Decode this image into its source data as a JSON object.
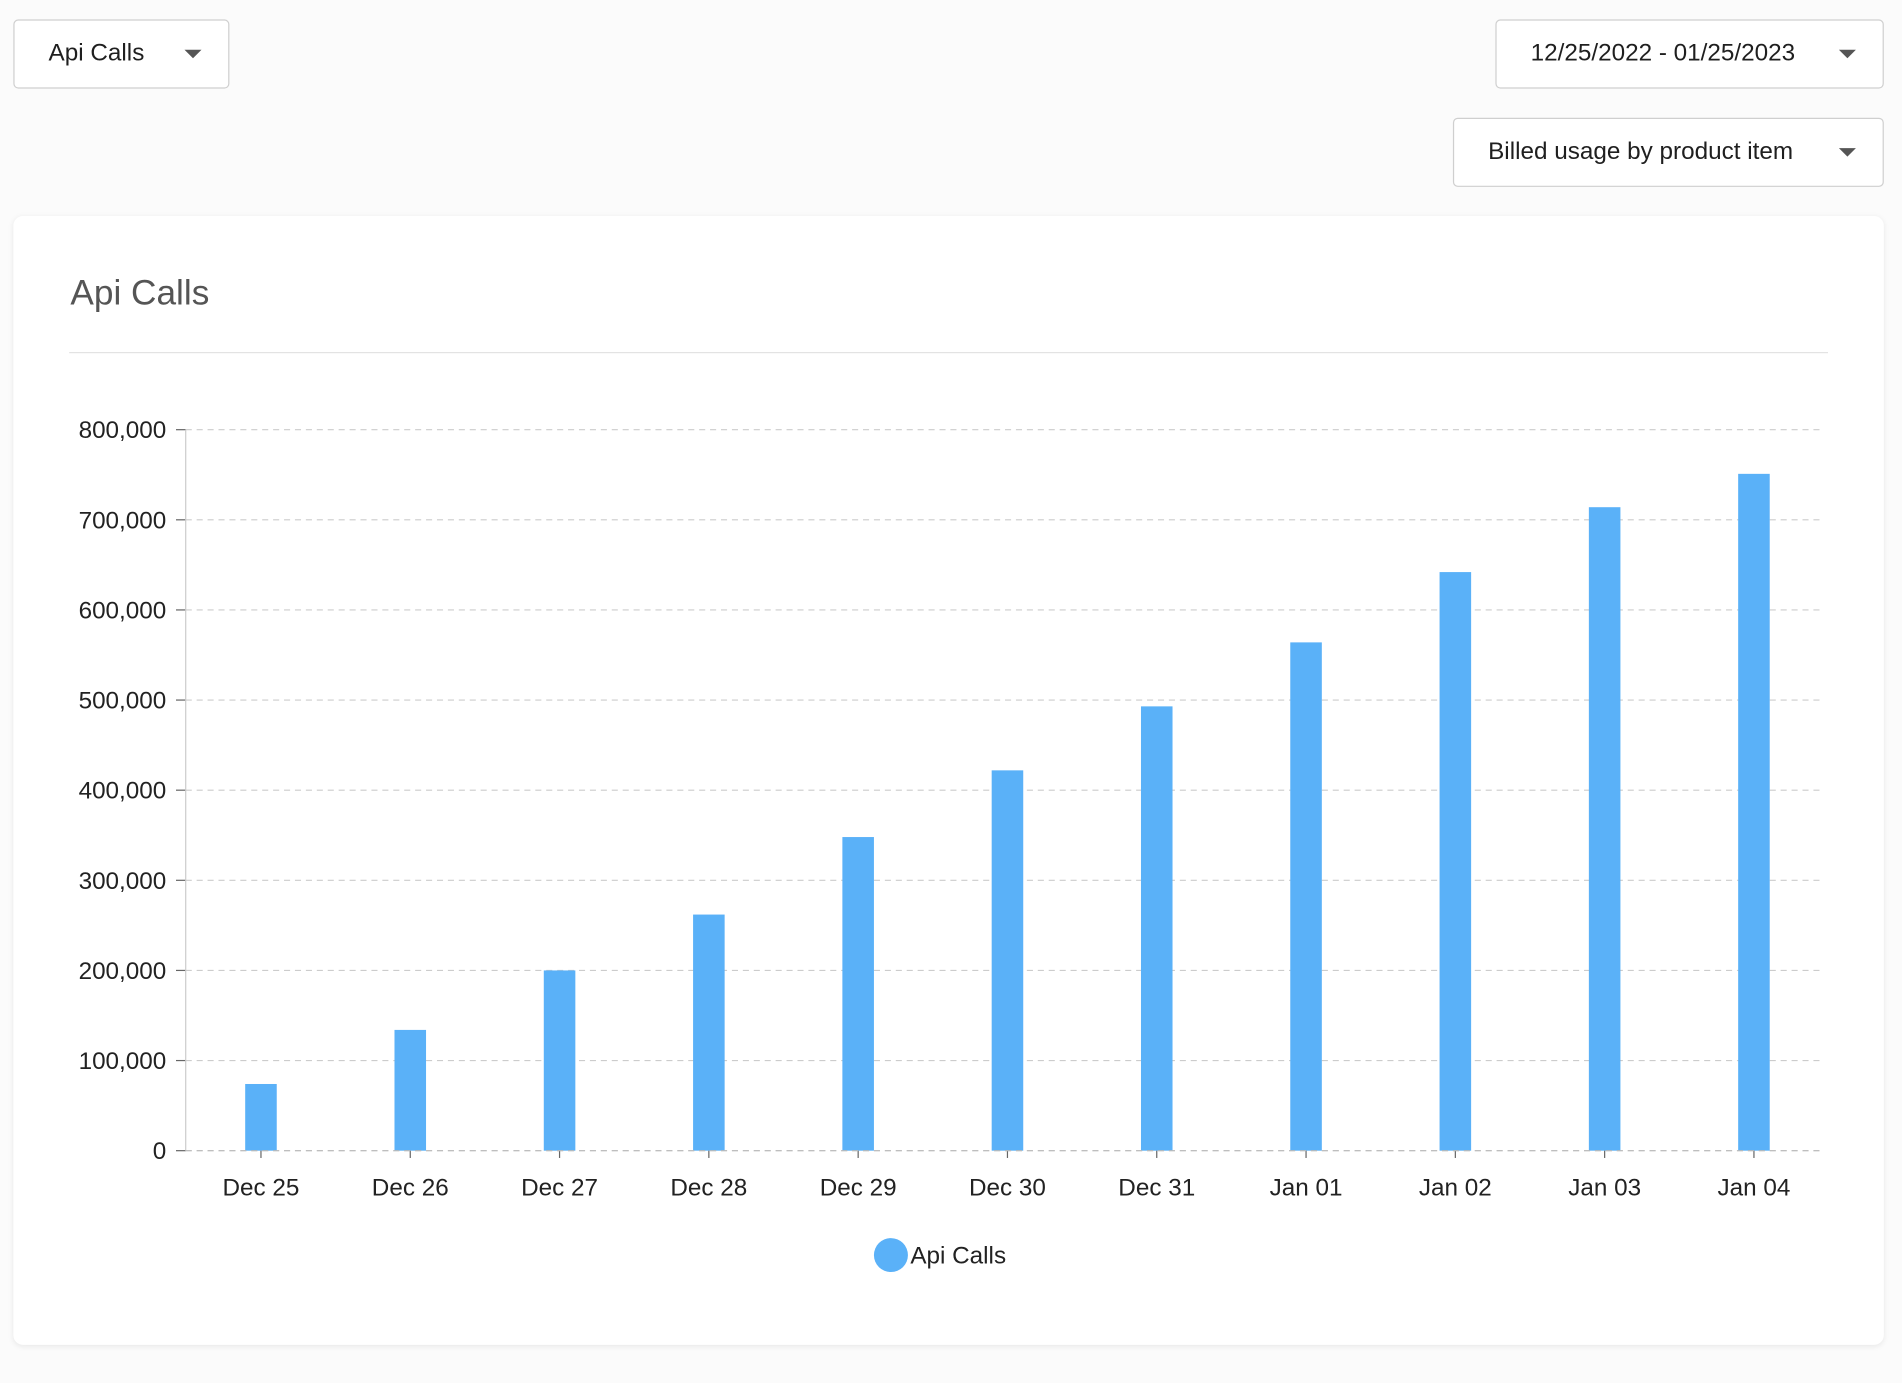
{
  "controls": {
    "metric_select": "Api Calls",
    "date_range": "12/25/2022 - 01/25/2023",
    "usage_select": "Billed usage by product item"
  },
  "card": {
    "title": "Api Calls"
  },
  "colors": {
    "bar": "#5ab1f8",
    "grid": "#cccccc",
    "axis": "#cccccc"
  },
  "icons": {
    "dropdown": "caret-down-icon"
  },
  "chart_data": {
    "type": "bar",
    "categories": [
      "Dec 25",
      "Dec 26",
      "Dec 27",
      "Dec 28",
      "Dec 29",
      "Dec 30",
      "Dec 31",
      "Jan 01",
      "Jan 02",
      "Jan 03",
      "Jan 04"
    ],
    "series": [
      {
        "name": "Api Calls",
        "values": [
          74000,
          134000,
          200000,
          262000,
          348000,
          422000,
          493000,
          564000,
          642000,
          714000,
          751000
        ]
      }
    ],
    "title": "Api Calls",
    "xlabel": "",
    "ylabel": "",
    "ylim": [
      0,
      800000
    ],
    "yticks": [
      0,
      100000,
      200000,
      300000,
      400000,
      500000,
      600000,
      700000,
      800000
    ],
    "ytick_labels": [
      "0",
      "100,000",
      "200,000",
      "300,000",
      "400,000",
      "500,000",
      "600,000",
      "700,000",
      "800,000"
    ],
    "grid": true,
    "legend": "bottom-center"
  }
}
